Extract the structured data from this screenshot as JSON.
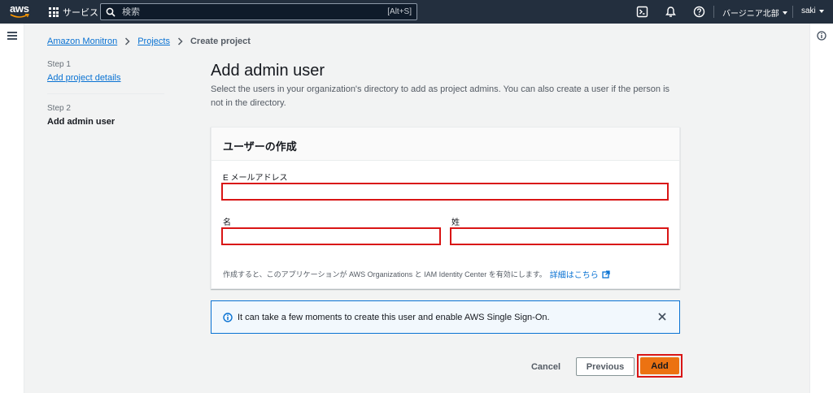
{
  "topnav": {
    "logo_text": "aws",
    "services_label": "サービス",
    "search_placeholder": "検索",
    "search_shortcut": "[Alt+S]",
    "region_label": "バージニア北部",
    "user_label": "saki",
    "icons": [
      "grid-icon",
      "search-icon",
      "cloudshell-icon",
      "bell-icon",
      "help-icon"
    ]
  },
  "breadcrumb": {
    "items": [
      "Amazon Monitron",
      "Projects",
      "Create project"
    ]
  },
  "steps": {
    "step1_num": "Step 1",
    "step1_label": "Add project details",
    "step2_num": "Step 2",
    "step2_label": "Add admin user"
  },
  "main": {
    "title": "Add admin user",
    "description": "Select the users in your organization's directory to add as project admins. You can also create a user if the person is not in the directory."
  },
  "form": {
    "header": "ユーザーの作成",
    "email_label": "E メールアドレス",
    "email_value": "",
    "first_name_label": "名",
    "first_name_value": "",
    "last_name_label": "姓",
    "last_name_value": "",
    "hint_text": "作成すると、このアプリケーションが AWS Organizations と IAM Identity Center を有効にします。",
    "hint_link": "詳細はこちら"
  },
  "alert": {
    "text": "It can take a few moments to create this user and enable AWS Single Sign-On."
  },
  "actions": {
    "cancel": "Cancel",
    "previous": "Previous",
    "add": "Add"
  },
  "colors": {
    "nav_bg": "#232f3e",
    "link": "#0972d3",
    "primary": "#ec7211",
    "highlight": "#d91515",
    "info_bg": "#f2f8fd"
  }
}
